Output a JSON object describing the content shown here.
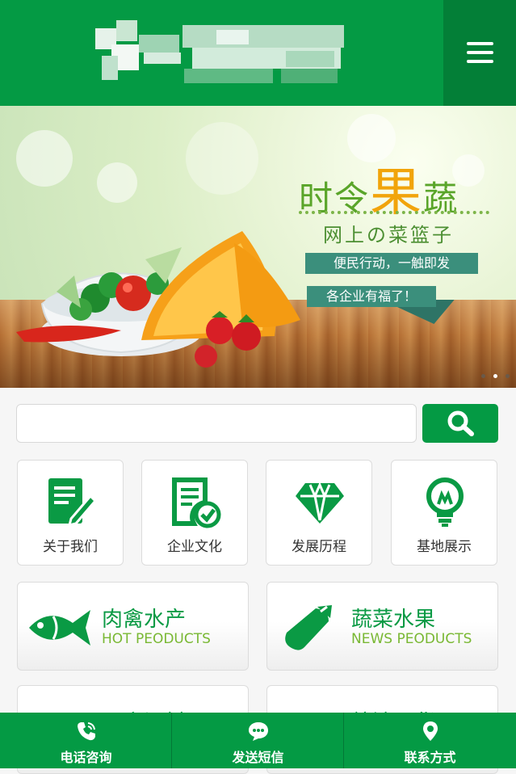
{
  "header": {
    "logo_icon": "logo-blurred",
    "menu_icon": "hamburger-icon"
  },
  "banner": {
    "title_pre": "时令",
    "title_big": "果",
    "title_post": "蔬",
    "subtitle": "网上の菜篮子",
    "ribbon1": "便民行动，一触即发",
    "ribbon2": "各企业有福了！",
    "slide_count": 3,
    "active_slide": 2
  },
  "search": {
    "value": "",
    "placeholder": "",
    "button_icon": "search-icon"
  },
  "nav_tiles": [
    {
      "label": "关于我们",
      "icon": "note-pen-icon"
    },
    {
      "label": "企业文化",
      "icon": "document-check-icon"
    },
    {
      "label": "发展历程",
      "icon": "diamond-icon"
    },
    {
      "label": "基地展示",
      "icon": "lightbulb-icon"
    }
  ],
  "categories": [
    {
      "name": "肉禽水产",
      "en": "HOT PEODUCTS",
      "icon": "fish-icon"
    },
    {
      "name": "蔬菜水果",
      "en": "NEWS PEODUCTS",
      "icon": "eggplant-icon"
    },
    {
      "name": "厨房调料",
      "en": "",
      "icon": "bowl-icon"
    },
    {
      "name": "粮油干货",
      "en": "",
      "icon": "grain-icon"
    }
  ],
  "footer": [
    {
      "label": "电话咨询",
      "icon": "phone-icon"
    },
    {
      "label": "发送短信",
      "icon": "message-icon"
    },
    {
      "label": "联系方式",
      "icon": "location-pin-icon"
    }
  ],
  "colors": {
    "primary": "#049a44",
    "primary_dark": "#037f37",
    "accent_green": "#79b833"
  }
}
